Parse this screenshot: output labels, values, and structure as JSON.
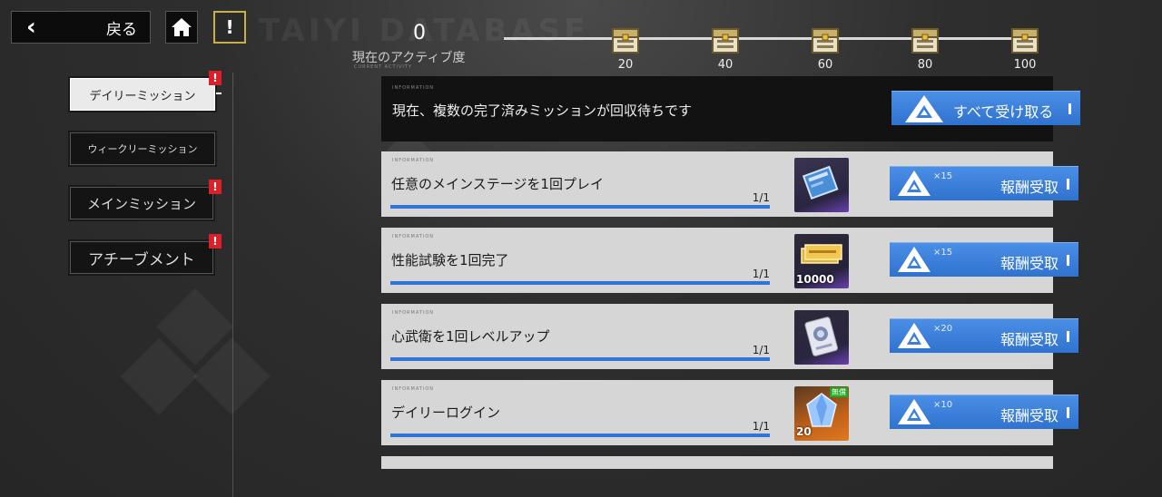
{
  "header": {
    "back_label": "戻る",
    "alert_label": "!",
    "watermark": "TAIYI DATABASE"
  },
  "activity": {
    "value": "0",
    "label": "現在のアクティブ度",
    "sub_label": "CURRENT ACTIVITY",
    "milestones": [
      "20",
      "40",
      "60",
      "80",
      "100"
    ]
  },
  "tabs": [
    {
      "label": "デイリーミッション",
      "active": true,
      "badge": "!"
    },
    {
      "label": "ウィークリーミッション",
      "active": false,
      "badge": ""
    },
    {
      "label": "メインミッション",
      "active": false,
      "badge": "!"
    },
    {
      "label": "アチーブメント",
      "active": false,
      "badge": "!"
    }
  ],
  "banner": {
    "tag": "INFORMATION",
    "text": "現在、複数の完了済みミッションが回収待ちです",
    "claim_all_label": "すべて受け取る"
  },
  "missions": [
    {
      "name": "任意のメインステージを1回プレイ",
      "progress": "1/1",
      "progress_fraction": 1.0,
      "reward_icon": "ticket-icon",
      "reward_qty": "",
      "reward_tag": "",
      "multiplier": "×15",
      "claim_label": "報酬受取"
    },
    {
      "name": "性能試験を1回完了",
      "progress": "1/1",
      "progress_fraction": 1.0,
      "reward_icon": "gold-bars-icon",
      "reward_qty": "10000",
      "reward_tag": "",
      "multiplier": "×15",
      "claim_label": "報酬受取"
    },
    {
      "name": "心武衛を1回レベルアップ",
      "progress": "1/1",
      "progress_fraction": 1.0,
      "reward_icon": "data-card-icon",
      "reward_qty": "",
      "reward_tag": "",
      "multiplier": "×20",
      "claim_label": "報酬受取"
    },
    {
      "name": "デイリーログイン",
      "progress": "1/1",
      "progress_fraction": 1.0,
      "reward_icon": "crystal-icon",
      "reward_qty": "20",
      "reward_tag": "無償",
      "multiplier": "×10",
      "claim_label": "報酬受取"
    }
  ],
  "colors": {
    "accent_blue": "#3a80dc",
    "badge_red": "#d8212a",
    "free_green": "#23a823"
  }
}
